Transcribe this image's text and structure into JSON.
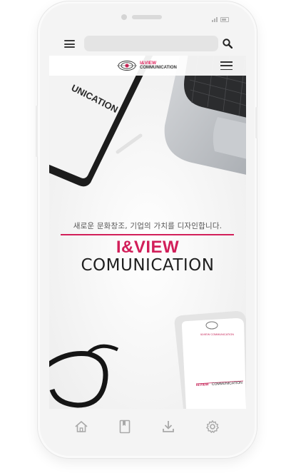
{
  "browser": {
    "search_placeholder": ""
  },
  "site": {
    "logo_line1": "I&VIEW",
    "logo_line2": "COMMUNICATION"
  },
  "hero": {
    "tagline": "새로운 문화창조, 기업의 가치를 디자인합니다.",
    "brand_line1": "I&VIEW",
    "brand_line2": "COMUNICATION",
    "tablet_text": "UNICATION",
    "phone_mock_logo": "I&VIEW COMMUNICATION",
    "phone_mock_brand1": "I&VIEW",
    "phone_mock_brand2": "COMMUNICATION"
  },
  "nav": {
    "items": [
      "home-icon",
      "bookmark-icon",
      "download-icon",
      "settings-icon"
    ]
  },
  "colors": {
    "accent": "#d21f5a",
    "frame": "#f4f4f4"
  }
}
